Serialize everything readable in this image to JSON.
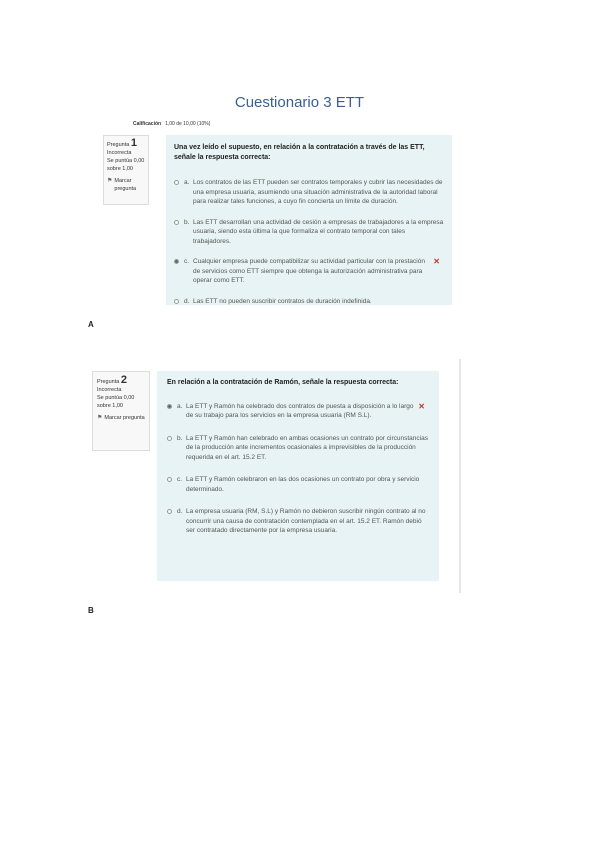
{
  "document": {
    "title": "Cuestionario 3 ETT"
  },
  "figures": [
    {
      "label": "A",
      "grade_line": {
        "label": "Calificación",
        "value": "1,00 de 10,00 (10%)"
      },
      "info": {
        "question_word": "Pregunta",
        "number": "1",
        "status": "Incorrecta",
        "score": "Se puntúa 0,00 sobre 1,00",
        "flag_label": "Marcar pregunta"
      },
      "question": "Una vez leído el supuesto, en relación a la contratación a través de las ETT, señale la respuesta correcta:",
      "options": [
        {
          "letter": "a.",
          "text": "Los contratos de las ETT pueden ser contratos temporales y cubrir las necesidades de una empresa usuaria, asumiendo una situación administrativa de la autoridad laboral para realizar tales funciones, a cuyo fin concierta un límite de duración.",
          "checked": false,
          "wrong": false
        },
        {
          "letter": "b.",
          "text": "Las ETT desarrollan una actividad de cesión a empresas de trabajadores a la empresa usuaria, siendo esta última la que formaliza el contrato temporal con tales trabajadores.",
          "checked": false,
          "wrong": false
        },
        {
          "letter": "c.",
          "text": "Cualquier empresa puede compatibilizar su actividad particular con la prestación de servicios como ETT siempre que obtenga la autorización administrativa para operar como ETT.",
          "checked": true,
          "wrong": true
        },
        {
          "letter": "d.",
          "text": "Las ETT no pueden suscribir contratos de duración indefinida.",
          "checked": false,
          "wrong": false
        }
      ]
    },
    {
      "label": "B",
      "info": {
        "question_word": "Pregunta",
        "number": "2",
        "status": "Incorrecta",
        "score": "Se puntúa 0,00 sobre 1,00",
        "flag_label": "Marcar pregunta"
      },
      "question": "En relación a la contratación de Ramón, señale la respuesta correcta:",
      "options": [
        {
          "letter": "a.",
          "text": "La ETT y Ramón ha celebrado dos contratos de puesta a disposición a lo largo de su trabajo para los servicios en la empresa usuaria (RM S.L).",
          "checked": true,
          "wrong": true
        },
        {
          "letter": "b.",
          "text": "La ETT y Ramón han celebrado en ambas ocasiones un contrato por circunstancias de la producción ante incrementos ocasionales a imprevisibles de la producción requerida en el art. 15.2 ET.",
          "checked": false,
          "wrong": false
        },
        {
          "letter": "c.",
          "text": "La ETT y Ramón celebraron en las dos ocasiones un contrato por obra y servicio determinado.",
          "checked": false,
          "wrong": false
        },
        {
          "letter": "d.",
          "text": "La empresa usuaria (RM, S.L) y Ramón no debieron suscribir ningún contrato al no concurrir una causa de contratación contemplada en el art. 15.2 ET. Ramón debió ser contratado directamente por la empresa usuaria.",
          "checked": false,
          "wrong": false
        }
      ]
    }
  ],
  "icons": {
    "wrong": "cross-icon",
    "flag": "flag-icon",
    "wrong_color": "#c0392b",
    "panel_color": "#e7f3f5",
    "title_color": "#3a5f93"
  }
}
